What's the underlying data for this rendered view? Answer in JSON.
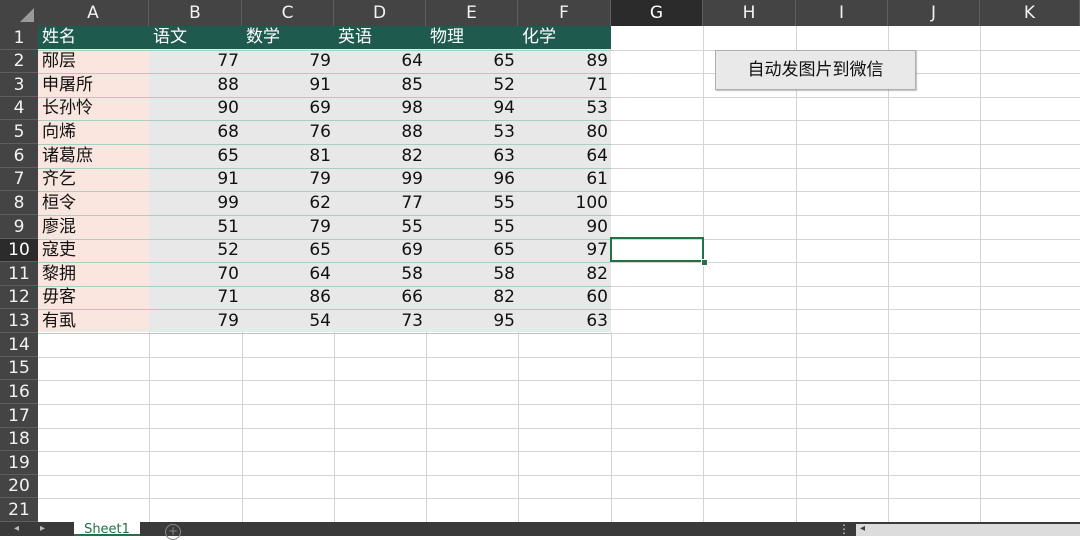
{
  "columns": [
    "A",
    "B",
    "C",
    "D",
    "E",
    "F",
    "G",
    "H",
    "I",
    "J",
    "K"
  ],
  "rows": [
    "1",
    "2",
    "3",
    "4",
    "5",
    "6",
    "7",
    "8",
    "9",
    "10",
    "11",
    "12",
    "13",
    "14",
    "15",
    "16",
    "17",
    "18",
    "19",
    "20",
    "21"
  ],
  "table": {
    "headers": [
      "姓名",
      "语文",
      "数学",
      "英语",
      "物理",
      "化学"
    ],
    "records": [
      [
        "邴层",
        "77",
        "79",
        "64",
        "65",
        "89"
      ],
      [
        "申屠所",
        "88",
        "91",
        "85",
        "52",
        "71"
      ],
      [
        "长孙怜",
        "90",
        "69",
        "98",
        "94",
        "53"
      ],
      [
        "向烯",
        "68",
        "76",
        "88",
        "53",
        "80"
      ],
      [
        "诸葛庶",
        "65",
        "81",
        "82",
        "63",
        "64"
      ],
      [
        "齐乞",
        "91",
        "79",
        "99",
        "96",
        "61"
      ],
      [
        "桓令",
        "99",
        "62",
        "77",
        "55",
        "100"
      ],
      [
        "廖混",
        "51",
        "79",
        "55",
        "55",
        "90"
      ],
      [
        "寇吏",
        "52",
        "65",
        "69",
        "65",
        "97"
      ],
      [
        "黎拥",
        "70",
        "64",
        "58",
        "58",
        "82"
      ],
      [
        "毋客",
        "71",
        "86",
        "66",
        "82",
        "60"
      ],
      [
        "有虱",
        "79",
        "54",
        "73",
        "95",
        "63"
      ]
    ]
  },
  "selection": {
    "column": "G",
    "row": "10"
  },
  "macro_button": {
    "label": "自动发图片到微信"
  },
  "sheet_tabs": [
    {
      "label": "Sheet1",
      "active": true
    }
  ],
  "icons": {
    "select_all": "select-all-triangle",
    "nav_prev": "◂",
    "nav_next": "▸",
    "add_sheet": "+",
    "more": "⋮",
    "scroll_left": "◂"
  },
  "colors": {
    "header_fill": "#1e5a4e",
    "name_fill": "#fbe6df",
    "data_fill": "#e8e8e8",
    "accent": "#217346"
  }
}
